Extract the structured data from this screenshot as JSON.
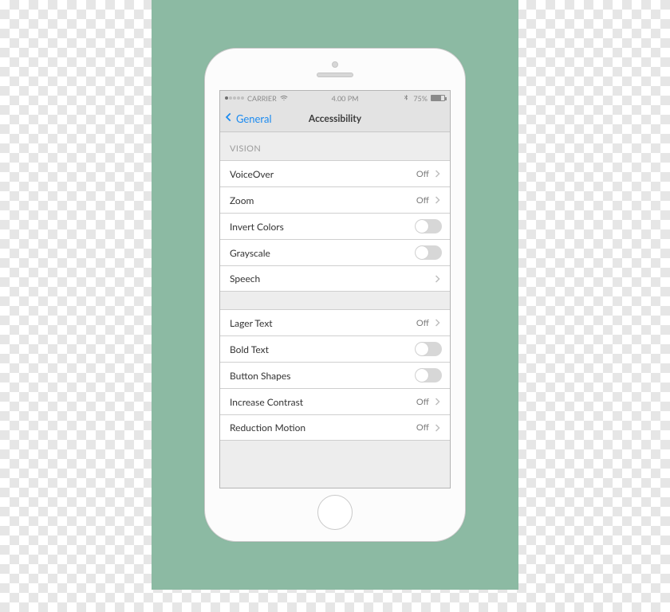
{
  "status": {
    "carrier": "CARRIER",
    "time": "4.00 PM",
    "battery_pct": "75%"
  },
  "nav": {
    "back_label": "General",
    "title": "Accessibility"
  },
  "sections": {
    "vision_header": "VISION"
  },
  "rows": {
    "voiceover": {
      "label": "VoiceOver",
      "value": "Off"
    },
    "zoom": {
      "label": "Zoom",
      "value": "Off"
    },
    "invert": {
      "label": "Invert Colors"
    },
    "grayscale": {
      "label": "Grayscale"
    },
    "speech": {
      "label": "Speech"
    },
    "larger_text": {
      "label": "Lager Text",
      "value": "Off"
    },
    "bold_text": {
      "label": "Bold Text"
    },
    "button_shapes": {
      "label": "Button Shapes"
    },
    "increase_contrast": {
      "label": "Increase Contrast",
      "value": "Off"
    },
    "reduce_motion": {
      "label": "Reduction Motion",
      "value": "Off"
    }
  }
}
